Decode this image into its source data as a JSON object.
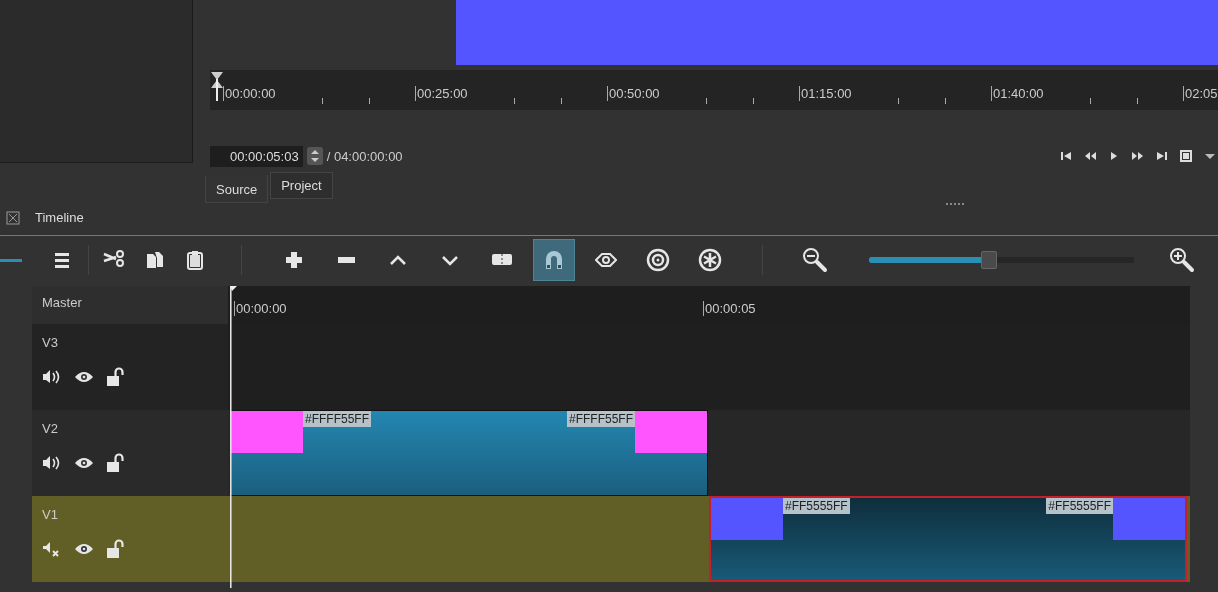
{
  "source_ruler": {
    "ticks": [
      "00:00:00",
      "00:25:00",
      "00:50:00",
      "01:15:00",
      "01:40:00",
      "02:05"
    ]
  },
  "transport": {
    "timecode": "00:00:05:03",
    "duration": "/ 04:00:00:00"
  },
  "tabs": [
    {
      "label": "Source",
      "selected": true
    },
    {
      "label": "Project",
      "selected": false
    }
  ],
  "timeline": {
    "title": "Timeline",
    "toolbar": [
      {
        "kind": "menu",
        "on": false
      },
      {
        "kind": "separator"
      },
      {
        "kind": "cut",
        "on": false
      },
      {
        "kind": "copy",
        "on": false
      },
      {
        "kind": "paste",
        "on": false
      },
      {
        "kind": "separator"
      },
      {
        "kind": "add",
        "on": false
      },
      {
        "kind": "remove",
        "on": false
      },
      {
        "kind": "lift",
        "on": false
      },
      {
        "kind": "overwrite",
        "on": false
      },
      {
        "kind": "split",
        "on": false
      },
      {
        "kind": "snap",
        "on": true
      },
      {
        "kind": "scrub",
        "on": false
      },
      {
        "kind": "ripple",
        "on": false
      },
      {
        "kind": "ripple-all",
        "on": false
      },
      {
        "kind": "separator"
      },
      {
        "kind": "zoom-out",
        "on": false
      },
      {
        "kind": "zoom-slider",
        "level": 0.45
      },
      {
        "kind": "zoom-in",
        "on": false
      }
    ],
    "ruler": {
      "label": "Master",
      "ticks": [
        "00:00:00",
        "00:00:05"
      ]
    },
    "tracks": [
      {
        "name": "V3",
        "muted": false,
        "hidden": false,
        "locked": false,
        "selected": false
      },
      {
        "name": "V2",
        "muted": false,
        "hidden": false,
        "locked": false,
        "selected": false,
        "clips": [
          {
            "kind": "clip",
            "selected": false,
            "color": "#ff55ff",
            "labels": [
              "#FFFF55FF",
              "#FFFF55FF"
            ]
          }
        ]
      },
      {
        "name": "V1",
        "muted": true,
        "hidden": false,
        "locked": false,
        "selected": true,
        "clips": [
          {
            "kind": "gap"
          },
          {
            "kind": "clip",
            "selected": true,
            "color": "#5555ff",
            "labels": [
              "#FF5555FF",
              "#FF5555FF"
            ]
          }
        ]
      }
    ]
  }
}
